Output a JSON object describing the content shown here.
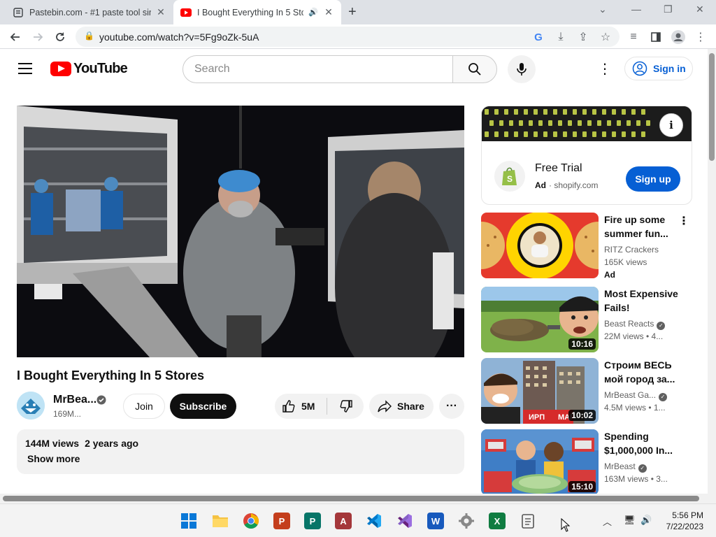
{
  "browser": {
    "tabs": [
      {
        "title": "Pastebin.com - #1 paste tool since 2002!",
        "active": false
      },
      {
        "title": "I Bought Everything In 5 Stores",
        "active": true
      }
    ],
    "url": "youtube.com/watch?v=5Fg9oZk-5uA"
  },
  "header": {
    "logo_text": "YouTube",
    "search_placeholder": "Search",
    "signin_label": "Sign in"
  },
  "video": {
    "title": "I Bought Everything In 5 Stores",
    "channel": "MrBea...",
    "subscribers": "169M...",
    "join_label": "Join",
    "subscribe_label": "Subscribe",
    "likes": "5M",
    "share_label": "Share",
    "views": "144M views",
    "age": "2 years ago",
    "show_more": "Show more"
  },
  "ad": {
    "title": "Free Trial",
    "ad_label": "Ad",
    "domain": "shopify.com",
    "cta": "Sign up"
  },
  "recommendations": [
    {
      "title": "Fire up some summer fun...",
      "channel": "RITZ Crackers",
      "views": "165K views",
      "ad": "Ad",
      "duration": "",
      "verified": false
    },
    {
      "title": "Most Expensive Fails!",
      "channel": "Beast Reacts",
      "views": "22M views  •  4...",
      "duration": "10:16",
      "verified": true
    },
    {
      "title": "Строим ВЕСЬ мой город за...",
      "channel": "MrBeast Ga...",
      "views": "4.5M views  •  1...",
      "duration": "10:02",
      "verified": true
    },
    {
      "title": "Spending $1,000,000 In...",
      "channel": "MrBeast",
      "views": "163M views  •  3...",
      "duration": "15:10",
      "verified": true
    }
  ],
  "taskbar": {
    "time": "5:56 PM",
    "date": "7/22/2023"
  },
  "colors": {
    "youtube_red": "#ff0000",
    "link_blue": "#065fd4",
    "subscribe_bg": "#0f0f0f"
  }
}
